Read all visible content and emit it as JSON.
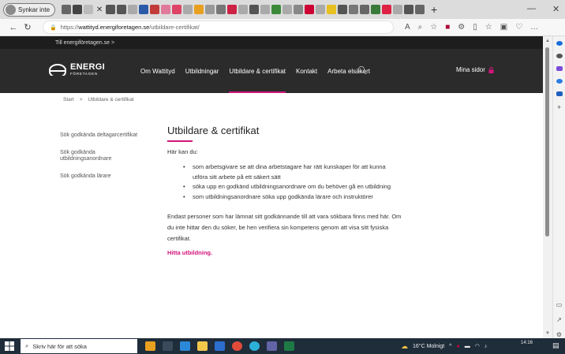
{
  "browser": {
    "profile_label": "Synkar inte",
    "url_prefix": "https://",
    "url_host": "wattityd.energiforetagen.se",
    "url_path": "/utbildare-certifikat/"
  },
  "site": {
    "top_link": "Till energiföretagen.se >",
    "logo_big": "ENERGI",
    "logo_small": "FÖRETAGEN",
    "nav": [
      "Om Wattityd",
      "Utbildningar",
      "Utbildare & certifikat",
      "Kontakt",
      "Arbeta elsäkert"
    ],
    "account_label": "Mina sidor"
  },
  "breadcrumb": {
    "home": "Start",
    "separator": ">",
    "current": "Utbildare & certifikat"
  },
  "sidenav": [
    "Sök godkända deltagarcertifikat",
    "Sök godkända utbildningsanordnare",
    "Sök godkända lärare"
  ],
  "main": {
    "title": "Utbildare & certifikat",
    "intro": "Här kan du:",
    "bullets": [
      "som arbetsgivare se att dina arbetstagare har rätt kunskaper för att kunna utföra sitt arbete på ett säkert sätt",
      "söka upp en godkänd utbildningsanordnare om du behöver gå en utbildning",
      "som utbildningsanordnare söka upp godkända lärare och instruktörer"
    ],
    "paragraph": "Endast personer som har lämnat sitt godkännande till att vara sökbara finns med här. Om du inte hittar den du söker, be hen verifiera sin kompetens genom att visa sitt fysiska certifikat.",
    "cta": "Hitta utbildning."
  },
  "taskbar": {
    "search_placeholder": "Skriv här för att söka",
    "weather": "16°C  Molnigt",
    "time": "14:16"
  },
  "colors": {
    "accent": "#d4147b",
    "nav_bg": "#2b2b2b",
    "taskbar_bg": "#1f2c3a"
  }
}
